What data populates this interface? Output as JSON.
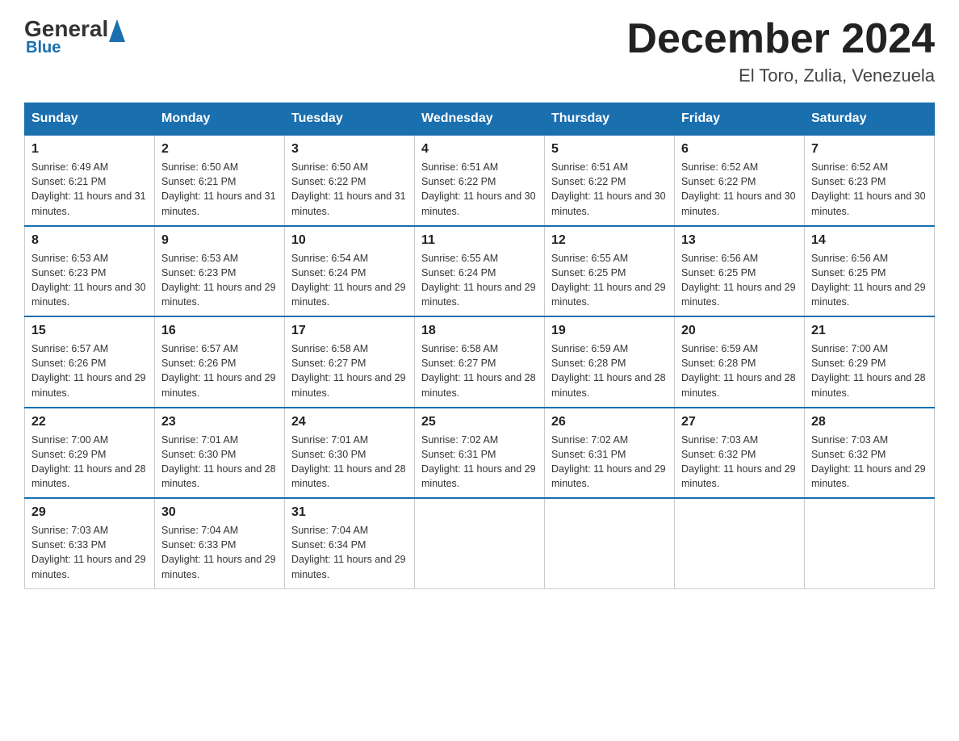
{
  "header": {
    "logo_general": "General",
    "logo_blue": "Blue",
    "month_title": "December 2024",
    "location": "El Toro, Zulia, Venezuela"
  },
  "days_of_week": [
    "Sunday",
    "Monday",
    "Tuesday",
    "Wednesday",
    "Thursday",
    "Friday",
    "Saturday"
  ],
  "weeks": [
    [
      {
        "day": "1",
        "sunrise": "6:49 AM",
        "sunset": "6:21 PM",
        "daylight": "11 hours and 31 minutes."
      },
      {
        "day": "2",
        "sunrise": "6:50 AM",
        "sunset": "6:21 PM",
        "daylight": "11 hours and 31 minutes."
      },
      {
        "day": "3",
        "sunrise": "6:50 AM",
        "sunset": "6:22 PM",
        "daylight": "11 hours and 31 minutes."
      },
      {
        "day": "4",
        "sunrise": "6:51 AM",
        "sunset": "6:22 PM",
        "daylight": "11 hours and 30 minutes."
      },
      {
        "day": "5",
        "sunrise": "6:51 AM",
        "sunset": "6:22 PM",
        "daylight": "11 hours and 30 minutes."
      },
      {
        "day": "6",
        "sunrise": "6:52 AM",
        "sunset": "6:22 PM",
        "daylight": "11 hours and 30 minutes."
      },
      {
        "day": "7",
        "sunrise": "6:52 AM",
        "sunset": "6:23 PM",
        "daylight": "11 hours and 30 minutes."
      }
    ],
    [
      {
        "day": "8",
        "sunrise": "6:53 AM",
        "sunset": "6:23 PM",
        "daylight": "11 hours and 30 minutes."
      },
      {
        "day": "9",
        "sunrise": "6:53 AM",
        "sunset": "6:23 PM",
        "daylight": "11 hours and 29 minutes."
      },
      {
        "day": "10",
        "sunrise": "6:54 AM",
        "sunset": "6:24 PM",
        "daylight": "11 hours and 29 minutes."
      },
      {
        "day": "11",
        "sunrise": "6:55 AM",
        "sunset": "6:24 PM",
        "daylight": "11 hours and 29 minutes."
      },
      {
        "day": "12",
        "sunrise": "6:55 AM",
        "sunset": "6:25 PM",
        "daylight": "11 hours and 29 minutes."
      },
      {
        "day": "13",
        "sunrise": "6:56 AM",
        "sunset": "6:25 PM",
        "daylight": "11 hours and 29 minutes."
      },
      {
        "day": "14",
        "sunrise": "6:56 AM",
        "sunset": "6:25 PM",
        "daylight": "11 hours and 29 minutes."
      }
    ],
    [
      {
        "day": "15",
        "sunrise": "6:57 AM",
        "sunset": "6:26 PM",
        "daylight": "11 hours and 29 minutes."
      },
      {
        "day": "16",
        "sunrise": "6:57 AM",
        "sunset": "6:26 PM",
        "daylight": "11 hours and 29 minutes."
      },
      {
        "day": "17",
        "sunrise": "6:58 AM",
        "sunset": "6:27 PM",
        "daylight": "11 hours and 29 minutes."
      },
      {
        "day": "18",
        "sunrise": "6:58 AM",
        "sunset": "6:27 PM",
        "daylight": "11 hours and 28 minutes."
      },
      {
        "day": "19",
        "sunrise": "6:59 AM",
        "sunset": "6:28 PM",
        "daylight": "11 hours and 28 minutes."
      },
      {
        "day": "20",
        "sunrise": "6:59 AM",
        "sunset": "6:28 PM",
        "daylight": "11 hours and 28 minutes."
      },
      {
        "day": "21",
        "sunrise": "7:00 AM",
        "sunset": "6:29 PM",
        "daylight": "11 hours and 28 minutes."
      }
    ],
    [
      {
        "day": "22",
        "sunrise": "7:00 AM",
        "sunset": "6:29 PM",
        "daylight": "11 hours and 28 minutes."
      },
      {
        "day": "23",
        "sunrise": "7:01 AM",
        "sunset": "6:30 PM",
        "daylight": "11 hours and 28 minutes."
      },
      {
        "day": "24",
        "sunrise": "7:01 AM",
        "sunset": "6:30 PM",
        "daylight": "11 hours and 28 minutes."
      },
      {
        "day": "25",
        "sunrise": "7:02 AM",
        "sunset": "6:31 PM",
        "daylight": "11 hours and 29 minutes."
      },
      {
        "day": "26",
        "sunrise": "7:02 AM",
        "sunset": "6:31 PM",
        "daylight": "11 hours and 29 minutes."
      },
      {
        "day": "27",
        "sunrise": "7:03 AM",
        "sunset": "6:32 PM",
        "daylight": "11 hours and 29 minutes."
      },
      {
        "day": "28",
        "sunrise": "7:03 AM",
        "sunset": "6:32 PM",
        "daylight": "11 hours and 29 minutes."
      }
    ],
    [
      {
        "day": "29",
        "sunrise": "7:03 AM",
        "sunset": "6:33 PM",
        "daylight": "11 hours and 29 minutes."
      },
      {
        "day": "30",
        "sunrise": "7:04 AM",
        "sunset": "6:33 PM",
        "daylight": "11 hours and 29 minutes."
      },
      {
        "day": "31",
        "sunrise": "7:04 AM",
        "sunset": "6:34 PM",
        "daylight": "11 hours and 29 minutes."
      },
      null,
      null,
      null,
      null
    ]
  ]
}
